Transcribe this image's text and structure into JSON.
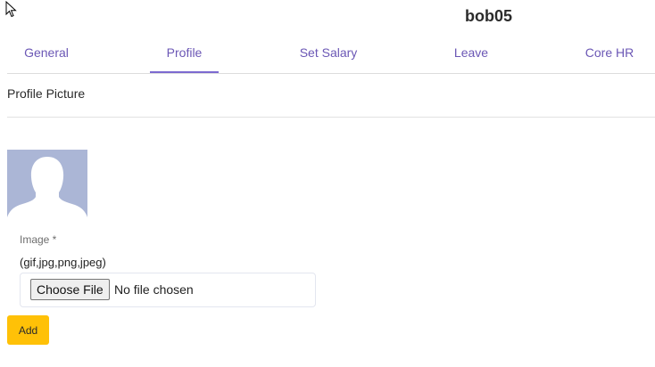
{
  "header": {
    "username": "bob05"
  },
  "tabs": [
    {
      "label": "General",
      "active": false
    },
    {
      "label": "Profile",
      "active": true
    },
    {
      "label": "Set Salary",
      "active": false
    },
    {
      "label": "Leave",
      "active": false
    },
    {
      "label": "Core HR",
      "active": false
    }
  ],
  "profile_picture": {
    "section_title": "Profile Picture",
    "avatar_icon": "default-user-silhouette-icon",
    "field_label": "Image *",
    "format_hint": "(gif,jpg,png,jpeg)",
    "choose_file_label": "Choose File",
    "file_status": "No file chosen",
    "add_label": "Add"
  },
  "colors": {
    "accent": "#6b57b5",
    "avatar_bg": "#abb6d6",
    "add_button": "#ffc107"
  }
}
